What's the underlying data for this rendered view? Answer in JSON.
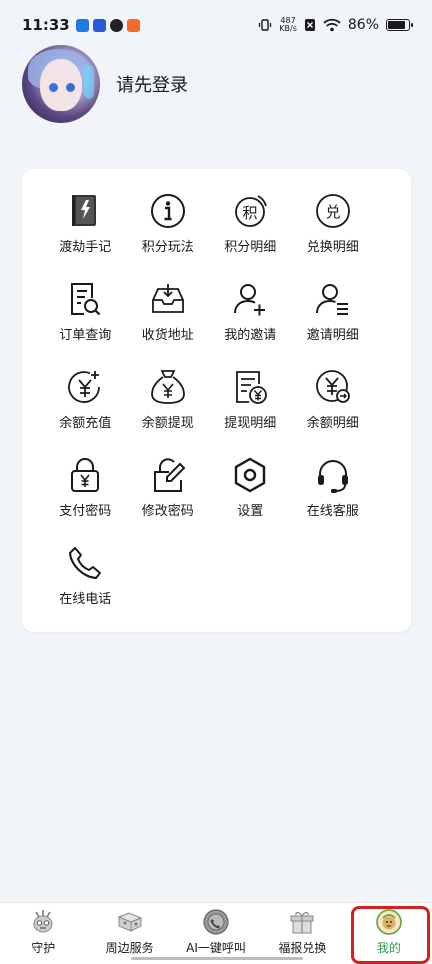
{
  "status_bar": {
    "time": "11:33",
    "net_speed_value": "487",
    "net_speed_unit": "KB/s",
    "battery": "86%",
    "app_colors": [
      "#1e7be6",
      "#2a5bd7",
      "#222222",
      "#f26b2b"
    ]
  },
  "profile": {
    "login_prompt": "请先登录"
  },
  "menu": {
    "items": [
      {
        "label": "渡劫手记",
        "icon": "book-lightning-icon"
      },
      {
        "label": "积分玩法",
        "icon": "info-icon"
      },
      {
        "label": "积分明细",
        "icon": "points-detail-icon"
      },
      {
        "label": "兑换明细",
        "icon": "exchange-detail-icon"
      },
      {
        "label": "订单查询",
        "icon": "order-search-icon"
      },
      {
        "label": "收货地址",
        "icon": "inbox-download-icon"
      },
      {
        "label": "我的邀请",
        "icon": "user-add-icon"
      },
      {
        "label": "邀请明细",
        "icon": "user-list-icon"
      },
      {
        "label": "余额充值",
        "icon": "yen-plus-icon"
      },
      {
        "label": "余额提现",
        "icon": "money-bag-icon"
      },
      {
        "label": "提现明细",
        "icon": "withdraw-record-icon"
      },
      {
        "label": "余额明细",
        "icon": "yen-transfer-icon"
      },
      {
        "label": "支付密码",
        "icon": "lock-yen-icon"
      },
      {
        "label": "修改密码",
        "icon": "edit-icon"
      },
      {
        "label": "设置",
        "icon": "gear-hexagon-icon"
      },
      {
        "label": "在线客服",
        "icon": "headset-icon"
      },
      {
        "label": "在线电话",
        "icon": "phone-icon"
      }
    ]
  },
  "bottom_nav": {
    "items": [
      {
        "label": "守护",
        "icon": "guardian-icon"
      },
      {
        "label": "周边服务",
        "icon": "nearby-services-icon"
      },
      {
        "label": "AI一键呼叫",
        "icon": "ai-call-icon"
      },
      {
        "label": "福报兑换",
        "icon": "blessing-exchange-icon"
      },
      {
        "label": "我的",
        "icon": "profile-icon"
      }
    ],
    "active_index": 4,
    "active_color": "#2f9e44",
    "highlight_color": "#d62020"
  }
}
